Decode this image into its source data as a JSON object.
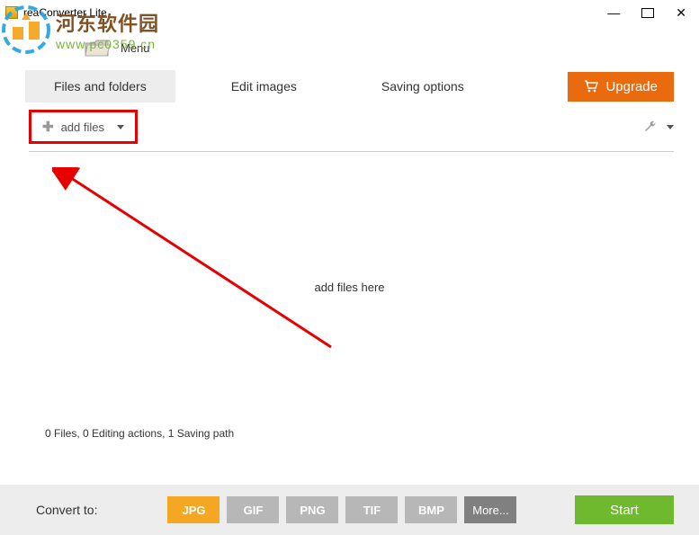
{
  "window": {
    "title": "reaConverter Lite"
  },
  "watermark": {
    "title": "河东软件园",
    "url": "www.pc0359.cn"
  },
  "menu": {
    "label": "Menu"
  },
  "tabs": {
    "files_folders": "Files and folders",
    "edit_images": "Edit images",
    "saving_options": "Saving options"
  },
  "upgrade": {
    "label": "Upgrade"
  },
  "toolbar": {
    "add_files": "add files"
  },
  "drop": {
    "placeholder": "add files here"
  },
  "status": {
    "text": "0 Files, 0 Editing actions, 1 Saving path"
  },
  "footer": {
    "convert_to": "Convert to:",
    "formats": {
      "jpg": "JPG",
      "gif": "GIF",
      "png": "PNG",
      "tif": "TIF",
      "bmp": "BMP",
      "more": "More..."
    },
    "start": "Start"
  },
  "colors": {
    "accent_orange": "#ea6a0e",
    "accent_green": "#6fb92e",
    "format_active": "#f5a623",
    "highlight_red": "#e60000"
  }
}
